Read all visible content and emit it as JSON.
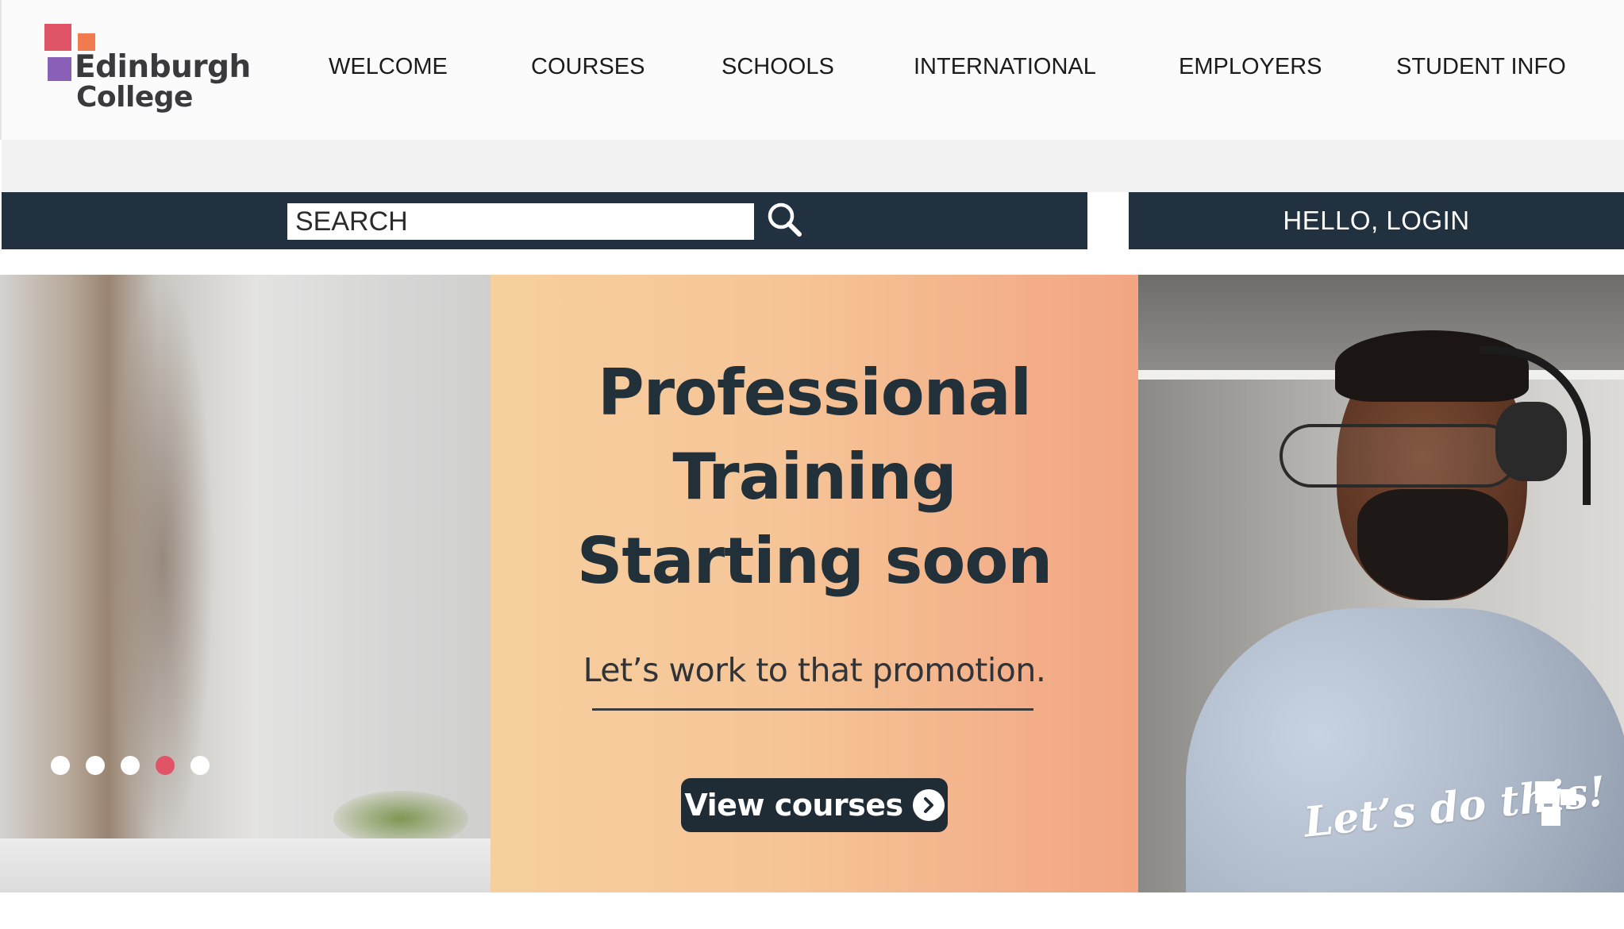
{
  "header": {
    "logo": {
      "line1": "Edinburgh",
      "line2": "College"
    },
    "nav": [
      {
        "label": "WELCOME"
      },
      {
        "label": "COURSES"
      },
      {
        "label": "SCHOOLS"
      },
      {
        "label": "INTERNATIONAL"
      },
      {
        "label": "EMPLOYERS"
      },
      {
        "label": "STUDENT INFO"
      }
    ]
  },
  "search": {
    "placeholder": "SEARCH",
    "icon": "search-icon"
  },
  "account": {
    "login_label": "HELLO, LOGIN"
  },
  "hero": {
    "title_lines": [
      "Professional",
      "Training",
      "Starting soon"
    ],
    "subtitle": "Let’s work to that promotion.",
    "cta_label": "View courses",
    "cta_icon": "chevron-right-icon",
    "tagline": "Let’s do this!",
    "slides": {
      "count": 5,
      "active_index": 3
    }
  },
  "colors": {
    "navy": "#21313f",
    "accent_red": "#e05468",
    "accent_orange": "#ef7b4e",
    "accent_purple": "#8a60b8",
    "hero_peach": "#f6c597"
  }
}
